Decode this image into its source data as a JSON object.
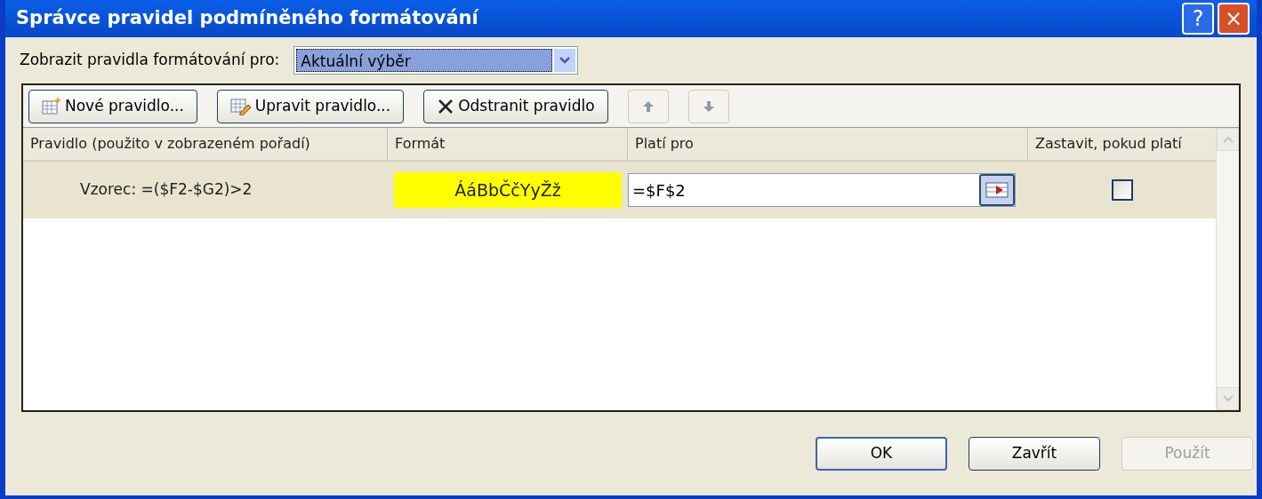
{
  "window": {
    "title": "Správce pravidel podmíněného formátování",
    "controls": [
      "?",
      "×"
    ]
  },
  "show_rules_for": {
    "label": "Zobrazit pravidla formátování pro:",
    "value": "Aktuální výběr"
  },
  "toolbar": [
    {
      "kind": "new",
      "label": "Nové pravidlo...",
      "disabled": false
    },
    {
      "kind": "edit",
      "label": "Upravit pravidlo...",
      "disabled": false
    },
    {
      "kind": "delete",
      "label": "Odstranit pravidlo",
      "disabled": false
    },
    {
      "kind": "up",
      "disabled": true
    },
    {
      "kind": "down",
      "disabled": true
    }
  ],
  "table": {
    "columns": [
      "Pravidlo (použito v zobrazeném pořadí)",
      "Formát",
      "Platí pro",
      "Zastavit, pokud platí"
    ],
    "rows": [
      {
        "rule": "Vzorec: =($F2-$G2)>2",
        "format_preview": "ÁáBbČčYyŽž",
        "color": "#ffff00",
        "applies_to": "=$F$2",
        "stop_if_true": false,
        "selected": true
      }
    ]
  },
  "buttons": [
    {
      "label": "OK",
      "disabled": false,
      "default": true
    },
    {
      "label": "Zavřít",
      "disabled": false,
      "default": false
    },
    {
      "label": "Použít",
      "disabled": true,
      "default": false
    }
  ]
}
